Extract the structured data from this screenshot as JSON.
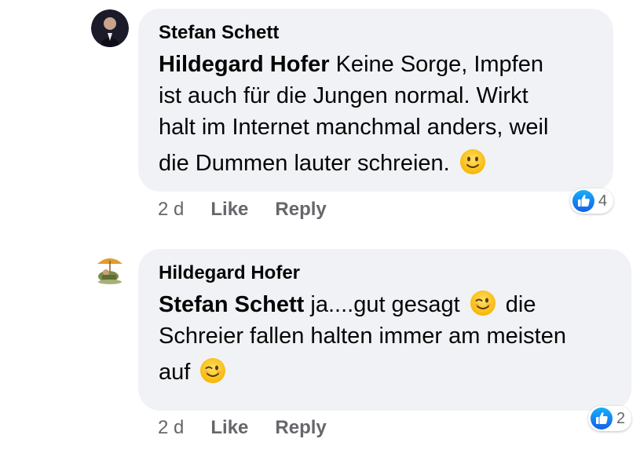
{
  "comments": [
    {
      "author": "Stefan Schett",
      "mention": "Hildegard Hofer",
      "lines": [
        "Keine Sorge, Impfen",
        "ist auch für die Jungen normal. Wirkt",
        "halt im Internet manchmal anders, weil",
        "die Dummen lauter schreien."
      ],
      "emoji": "slightly-smiling-face",
      "time": "2 d",
      "like_label": "Like",
      "reply_label": "Reply",
      "reaction_count": "4",
      "reaction_icon": "like-icon"
    },
    {
      "author": "Hildegard Hofer",
      "mention": "Stefan Schett",
      "lines": [
        "ja....gut gesagt",
        "die",
        "Schreier fallen halten immer am meisten",
        "auf"
      ],
      "emoji": "winking-face",
      "time": "2 d",
      "like_label": "Like",
      "reply_label": "Reply",
      "reaction_count": "2",
      "reaction_icon": "like-icon"
    }
  ],
  "colors": {
    "bubble": "#f0f2f5",
    "text": "#050505",
    "meta": "#65676b",
    "like_blue": "#1877f2"
  }
}
